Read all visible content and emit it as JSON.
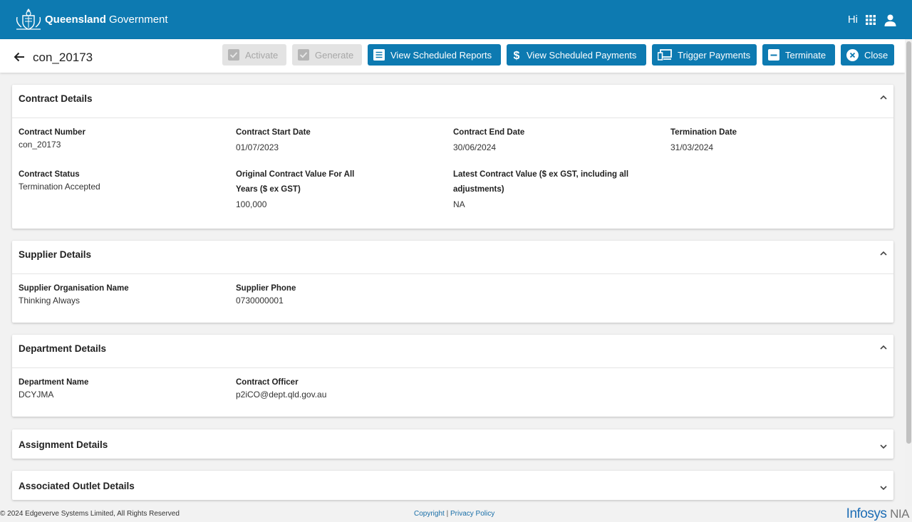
{
  "brand": {
    "bold": "Queensland",
    "rest": " Government"
  },
  "user": {
    "greeting": "Hi"
  },
  "header": {
    "title": "con_20173",
    "buttons": {
      "activate": "Activate",
      "generate": "Generate",
      "view_reports": "View Scheduled Reports",
      "view_payments": "View Scheduled Payments",
      "trigger_payments": "Trigger Payments",
      "terminate": "Terminate",
      "close": "Close"
    }
  },
  "contract_details": {
    "title": "Contract Details",
    "contract_number": {
      "label": "Contract Number",
      "value": "con_20173"
    },
    "start_date": {
      "label": "Contract Start Date",
      "value": "01/07/2023"
    },
    "end_date": {
      "label": "Contract End Date",
      "value": "30/06/2024"
    },
    "termination_date": {
      "label": "Termination Date",
      "value": "31/03/2024"
    },
    "status": {
      "label": "Contract Status",
      "value": "Termination Accepted"
    },
    "original_value": {
      "label_line1": "Original Contract Value For All",
      "label_line2": "Years ($ ex GST)",
      "value": "100,000"
    },
    "latest_value": {
      "label_line1": "Latest Contract Value ($ ex GST, including all",
      "label_line2": "adjustments)",
      "value": "NA"
    }
  },
  "supplier_details": {
    "title": "Supplier Details",
    "org_name": {
      "label": "Supplier Organisation Name",
      "value": "Thinking Always"
    },
    "phone": {
      "label": "Supplier Phone",
      "value": "0730000001"
    }
  },
  "department_details": {
    "title": "Department Details",
    "name": {
      "label": "Department Name",
      "value": "DCYJMA"
    },
    "officer": {
      "label": "Contract Officer",
      "value": "p2iCO@dept.qld.gov.au"
    }
  },
  "assignment_details": {
    "title": "Assignment Details"
  },
  "outlet_details": {
    "title": "Associated Outlet Details"
  },
  "footer": {
    "copyright": "© 2024 Edgeverve Systems Limited, All Rights Reserved",
    "link_copyright": "Copyright",
    "separator": "|",
    "link_privacy": "Privacy Policy",
    "logo_main": "Infosys",
    "logo_suffix": "NIA"
  },
  "colors": {
    "primary": "#0d7ab1",
    "background": "#f2f2f2"
  }
}
